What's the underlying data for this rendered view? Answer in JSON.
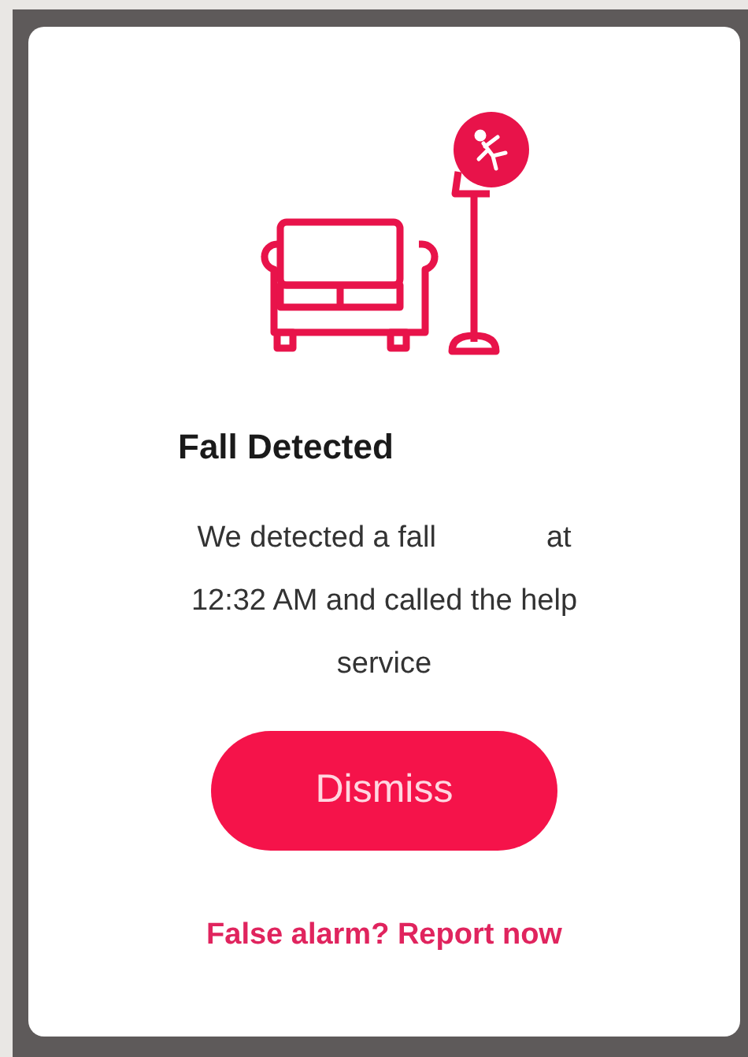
{
  "dialog": {
    "title": "Fall Detected",
    "message": "We detected a fall at 12:32 AM and called the help service",
    "primary_button": "Dismiss",
    "link": "False alarm? Report now"
  }
}
